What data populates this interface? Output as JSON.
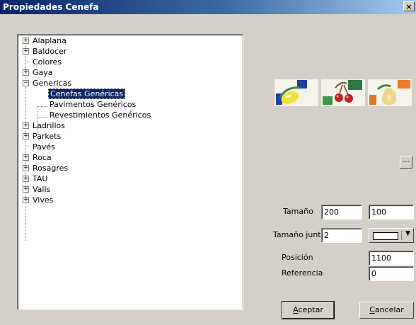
{
  "window": {
    "title": "Propiedades Cenefa",
    "close_label": "×"
  },
  "tree": {
    "nodes": [
      {
        "label": "Alaplana",
        "expander": "+"
      },
      {
        "label": "Baldocer",
        "expander": "+"
      },
      {
        "label": "Colores",
        "expander": ""
      },
      {
        "label": "Gaya",
        "expander": "+"
      },
      {
        "label": "Genericas",
        "expander": "−"
      },
      {
        "label": "Cenefas Genéricas",
        "expander": "",
        "selected": true
      },
      {
        "label": "Pavimentos Genéricos",
        "expander": ""
      },
      {
        "label": "Revestimientos Genéricos",
        "expander": ""
      },
      {
        "label": "Ladrillos",
        "expander": "+"
      },
      {
        "label": "Parkets",
        "expander": "+"
      },
      {
        "label": "Pavés",
        "expander": ""
      },
      {
        "label": "Roca",
        "expander": "+"
      },
      {
        "label": "Rosagres",
        "expander": "+"
      },
      {
        "label": "TAU",
        "expander": "+"
      },
      {
        "label": "Valls",
        "expander": "+"
      },
      {
        "label": "Vives",
        "expander": "+"
      }
    ]
  },
  "browse_button": {
    "label": "..."
  },
  "fields": {
    "tamano_label": "Tamaño",
    "tamano_w": "200",
    "tamano_h": "100",
    "junta_label": "Tamaño junta",
    "junta_value": "2",
    "junta_color": "#ffffff",
    "posicion_label": "Posición",
    "posicion_value": "1100",
    "referencia_label": "Referencia",
    "referencia_value": "0"
  },
  "buttons": {
    "accept_first": "A",
    "accept_rest": "ceptar",
    "cancel_first": "C",
    "cancel_rest": "ancelar"
  }
}
